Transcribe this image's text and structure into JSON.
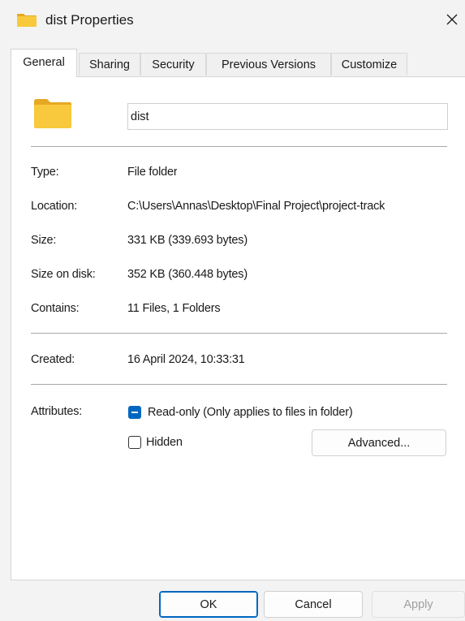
{
  "window": {
    "title": "dist Properties",
    "icon": "folder-icon",
    "close_icon": "close-icon"
  },
  "tabs": [
    {
      "label": "General",
      "active": true
    },
    {
      "label": "Sharing",
      "active": false
    },
    {
      "label": "Security",
      "active": false
    },
    {
      "label": "Previous Versions",
      "active": false
    },
    {
      "label": "Customize",
      "active": false
    }
  ],
  "general": {
    "folder_name": "dist",
    "type_label": "Type:",
    "type_value": "File folder",
    "location_label": "Location:",
    "location_value": "C:\\Users\\Annas\\Desktop\\Final Project\\project-track",
    "size_label": "Size:",
    "size_value": "331 KB (339.693 bytes)",
    "size_on_disk_label": "Size on disk:",
    "size_on_disk_value": "352 KB (360.448 bytes)",
    "contains_label": "Contains:",
    "contains_value": "11 Files, 1 Folders",
    "created_label": "Created:",
    "created_value": "16 April 2024, 10:33:31",
    "attributes_label": "Attributes:",
    "readonly_label": "Read-only (Only applies to files in folder)",
    "readonly_state": "indeterminate",
    "hidden_label": "Hidden",
    "hidden_state": "unchecked",
    "advanced_label": "Advanced..."
  },
  "footer": {
    "ok_label": "OK",
    "cancel_label": "Cancel",
    "apply_label": "Apply"
  },
  "colors": {
    "accent": "#0067c0",
    "folder_yellow": "#f8c93c",
    "folder_dark": "#e5a823",
    "window_bg": "#f3f3f3",
    "panel_bg": "#ffffff"
  }
}
